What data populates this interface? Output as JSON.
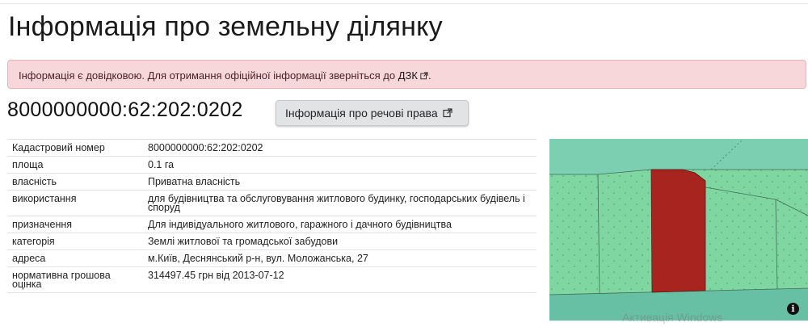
{
  "page": {
    "title": "Інформація про земельну ділянку"
  },
  "alert": {
    "text": "Інформація є довідковою. Для отримання офіційної інформації зверніться до",
    "link_label": "ДЗК",
    "suffix": "."
  },
  "parcel": {
    "cadastral_heading": "8000000000:62:202:0202",
    "rights_button_label": "Інформація про речові права"
  },
  "table": {
    "rows": [
      {
        "key": "Кадастровий номер",
        "value": "8000000000:62:202:0202"
      },
      {
        "key": "площа",
        "value": "0.1 га"
      },
      {
        "key": "власність",
        "value": "Приватна власність"
      },
      {
        "key": "використання",
        "value": "для будівництва та обслуговування житлового будинку, господарських будівель і споруд"
      },
      {
        "key": "призначення",
        "value": "Для індивідуального житлового, гаражного і дачного будівництва"
      },
      {
        "key": "категорія",
        "value": "Землі житлової та громадської забудови"
      },
      {
        "key": "адреса",
        "value": "м.Київ, Деснянський р-н, вул. Моложанська, 27"
      },
      {
        "key": "нормативна грошова оцінка",
        "value": "314497.45 грн від 2013-07-12"
      }
    ]
  },
  "map": {
    "colors": {
      "parcel_fill": "#a8241f",
      "land_fill": "#7fd6a1",
      "road_fill": "#6cc6a8",
      "border": "#3d6e55"
    },
    "info_icon": "i"
  },
  "watermark": {
    "text": "Активація Windows"
  },
  "colors": {
    "alert_bg": "#f8d7da",
    "button_bg": "#e2e3e5"
  }
}
